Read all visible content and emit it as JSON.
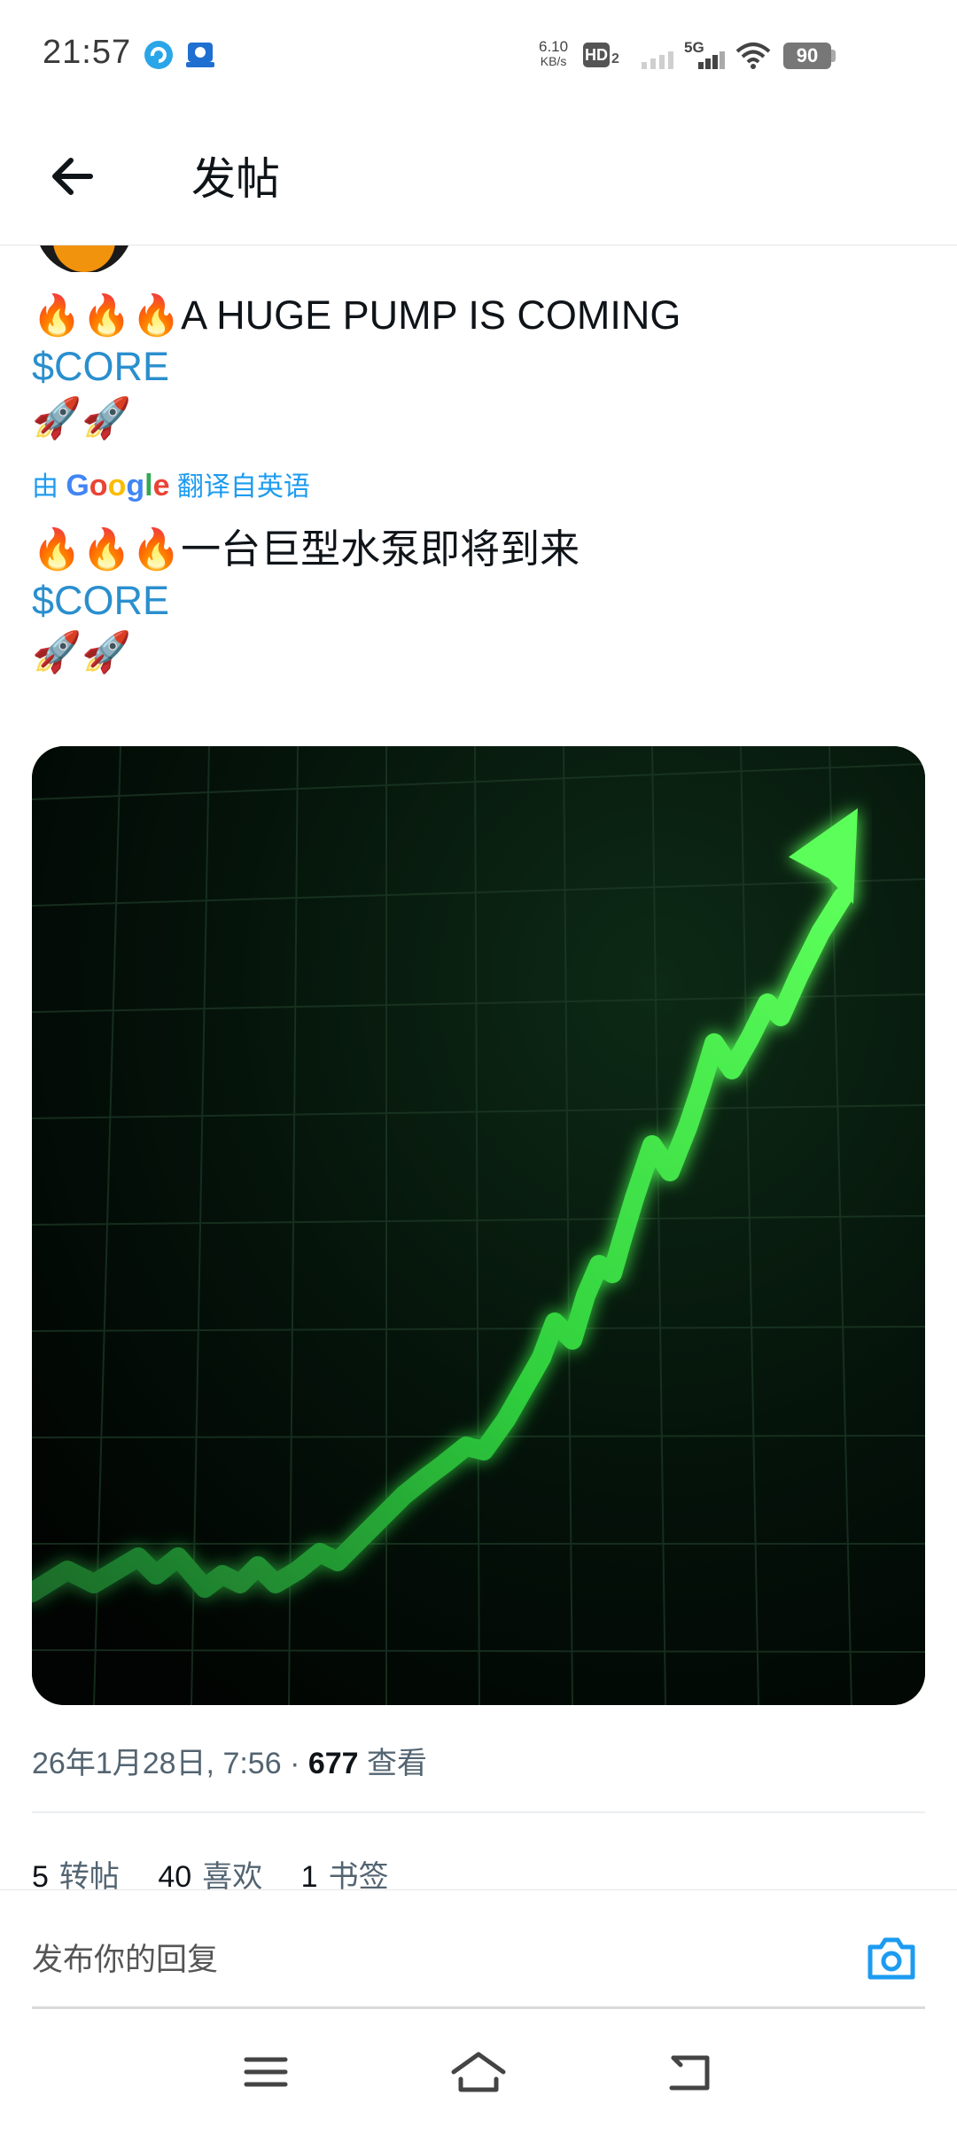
{
  "status_bar": {
    "time": "21:57",
    "net_speed_value": "6.10",
    "net_speed_unit": "KB/s",
    "hd_label": "HD",
    "hd_sub": "2",
    "network": "5G",
    "battery": "90"
  },
  "header": {
    "title": "发帖"
  },
  "post": {
    "text_line1_emoji": "🔥🔥🔥",
    "text_line1": "A HUGE PUMP IS COMING",
    "cashtag": "$CORE",
    "rockets": "🚀🚀",
    "translate_prefix": "由",
    "translate_brand": "Google",
    "translate_suffix": "翻译自英语",
    "translated_line1_emoji": "🔥🔥🔥",
    "translated_line1": "一台巨型水泵即将到来",
    "translated_cashtag": "$CORE",
    "translated_rockets": "🚀🚀"
  },
  "meta": {
    "date": "26年1月28日, 7:56",
    "separator": " · ",
    "views_count": "677",
    "views_label": "查看"
  },
  "stats": {
    "reposts_count": "5",
    "reposts_label": "转帖",
    "likes_count": "40",
    "likes_label": "喜欢",
    "bookmarks_count": "1",
    "bookmarks_label": "书签"
  },
  "reply": {
    "placeholder": "发布你的回复"
  },
  "colors": {
    "accent": "#1d9bf0",
    "chart_line": "#3dff4a",
    "chart_bg": "#020705"
  },
  "icons": {
    "back": "arrow-left-icon",
    "camera": "camera-icon",
    "nav_menu": "menu-icon",
    "nav_home": "home-icon",
    "nav_back": "back-icon"
  }
}
